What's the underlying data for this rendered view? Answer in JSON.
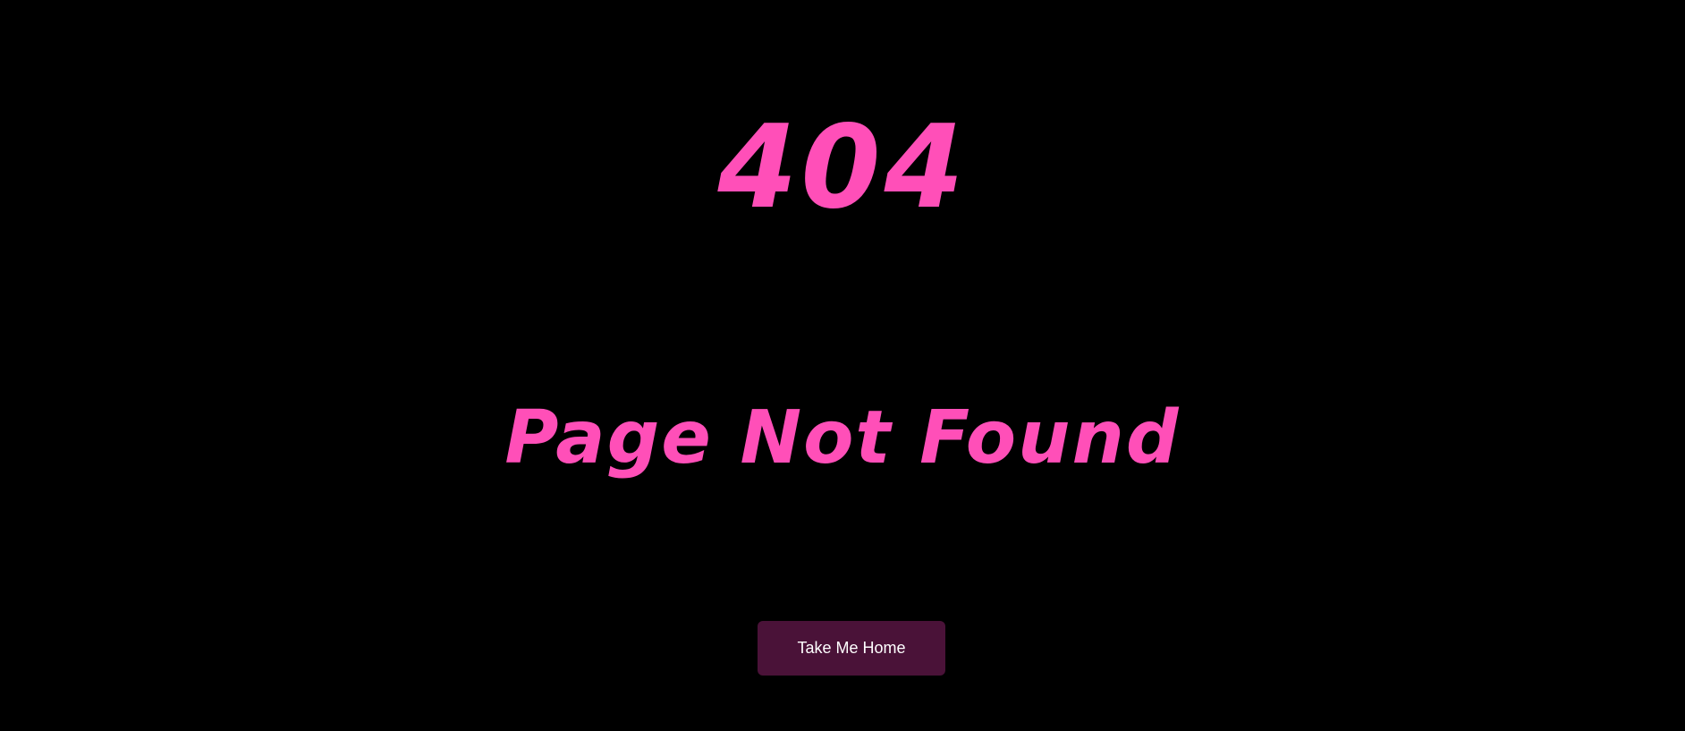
{
  "error": {
    "code": "404",
    "message": "Page Not Found"
  },
  "actions": {
    "home_label": "Take Me Home"
  },
  "colors": {
    "background": "#000000",
    "accent": "#ff4fb8",
    "button_bg": "#4a1238",
    "button_text": "#ffffff"
  }
}
